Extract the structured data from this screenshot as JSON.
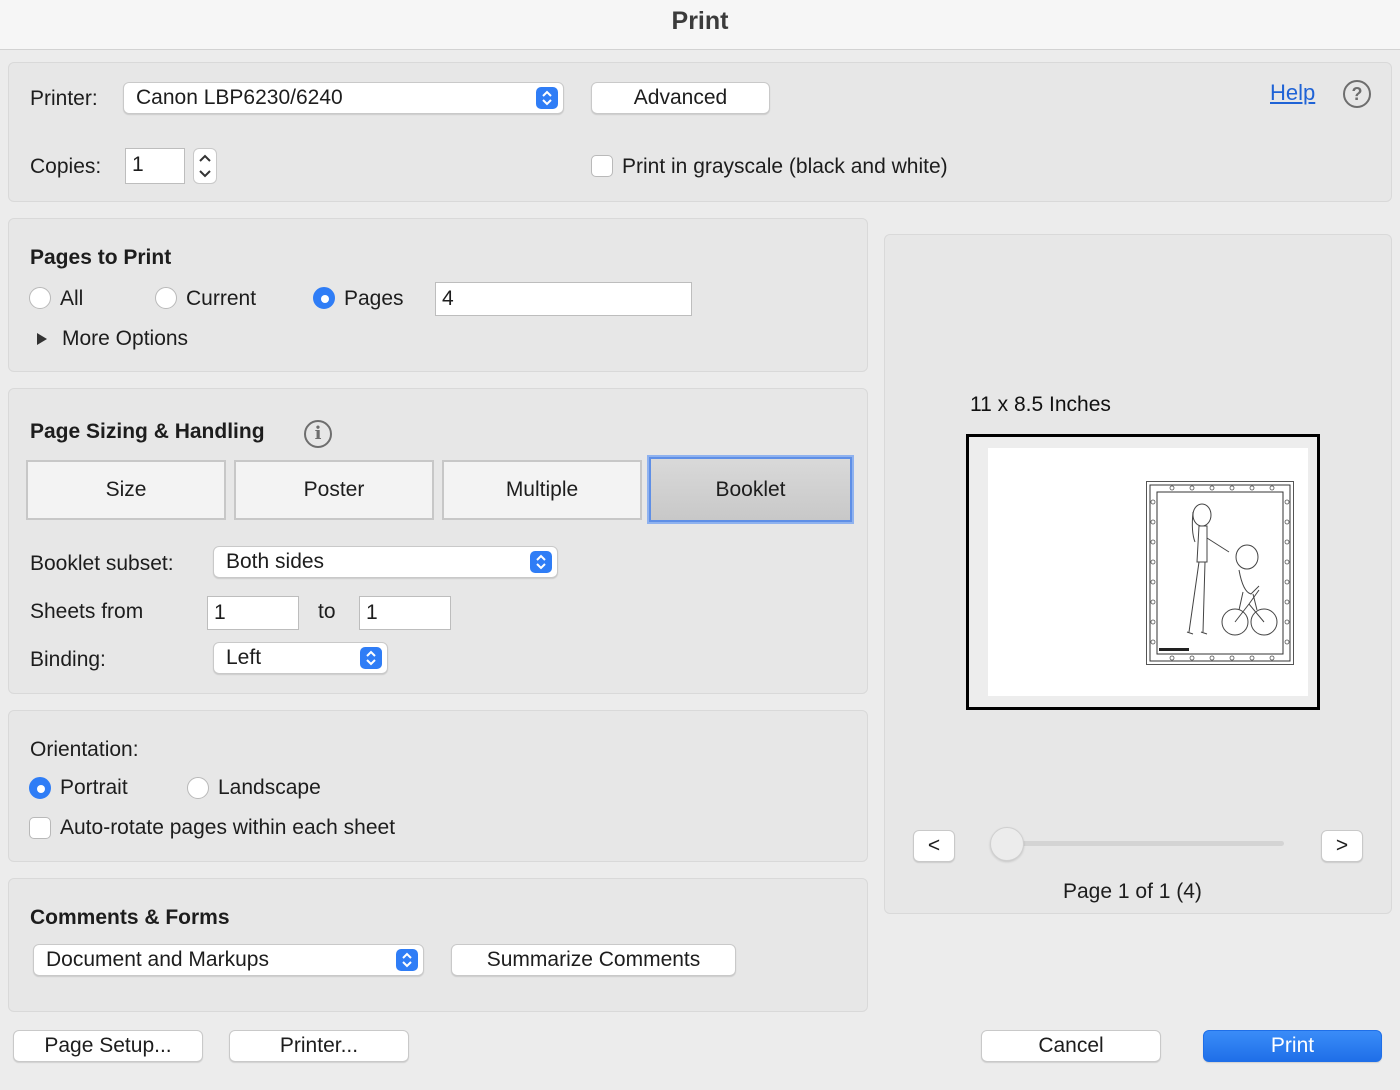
{
  "window": {
    "title": "Print"
  },
  "printer": {
    "label": "Printer:",
    "selected": "Canon LBP6230/6240",
    "advanced_label": "Advanced",
    "help_label": "Help"
  },
  "copies": {
    "label": "Copies:",
    "value": "1",
    "grayscale_label": "Print in grayscale (black and white)",
    "grayscale_checked": false
  },
  "pages_to_print": {
    "title": "Pages to Print",
    "options": [
      "All",
      "Current",
      "Pages"
    ],
    "selected": "Pages",
    "pages_value": "4",
    "more_options_label": "More Options"
  },
  "page_sizing": {
    "title": "Page Sizing & Handling",
    "modes": [
      "Size",
      "Poster",
      "Multiple",
      "Booklet"
    ],
    "selected_mode": "Booklet",
    "subset_label": "Booklet subset:",
    "subset_value": "Both sides",
    "sheets_from_label": "Sheets from",
    "sheets_from_value": "1",
    "sheets_to_label": "to",
    "sheets_to_value": "1",
    "binding_label": "Binding:",
    "binding_value": "Left"
  },
  "orientation": {
    "title": "Orientation:",
    "options": [
      "Portrait",
      "Landscape"
    ],
    "selected": "Portrait",
    "autorotate_label": "Auto-rotate pages within each sheet",
    "autorotate_checked": false
  },
  "comments_forms": {
    "title": "Comments & Forms",
    "selected": "Document and Markups",
    "summarize_label": "Summarize Comments"
  },
  "preview": {
    "size_label": "11 x 8.5 Inches",
    "prev_label": "<",
    "next_label": ">",
    "page_status": "Page 1 of 1 (4)",
    "slider_position": 0
  },
  "footer": {
    "page_setup_label": "Page Setup...",
    "printer_label": "Printer...",
    "cancel_label": "Cancel",
    "print_label": "Print"
  },
  "colors": {
    "accent": "#2f7df6",
    "link": "#1f63d6"
  }
}
